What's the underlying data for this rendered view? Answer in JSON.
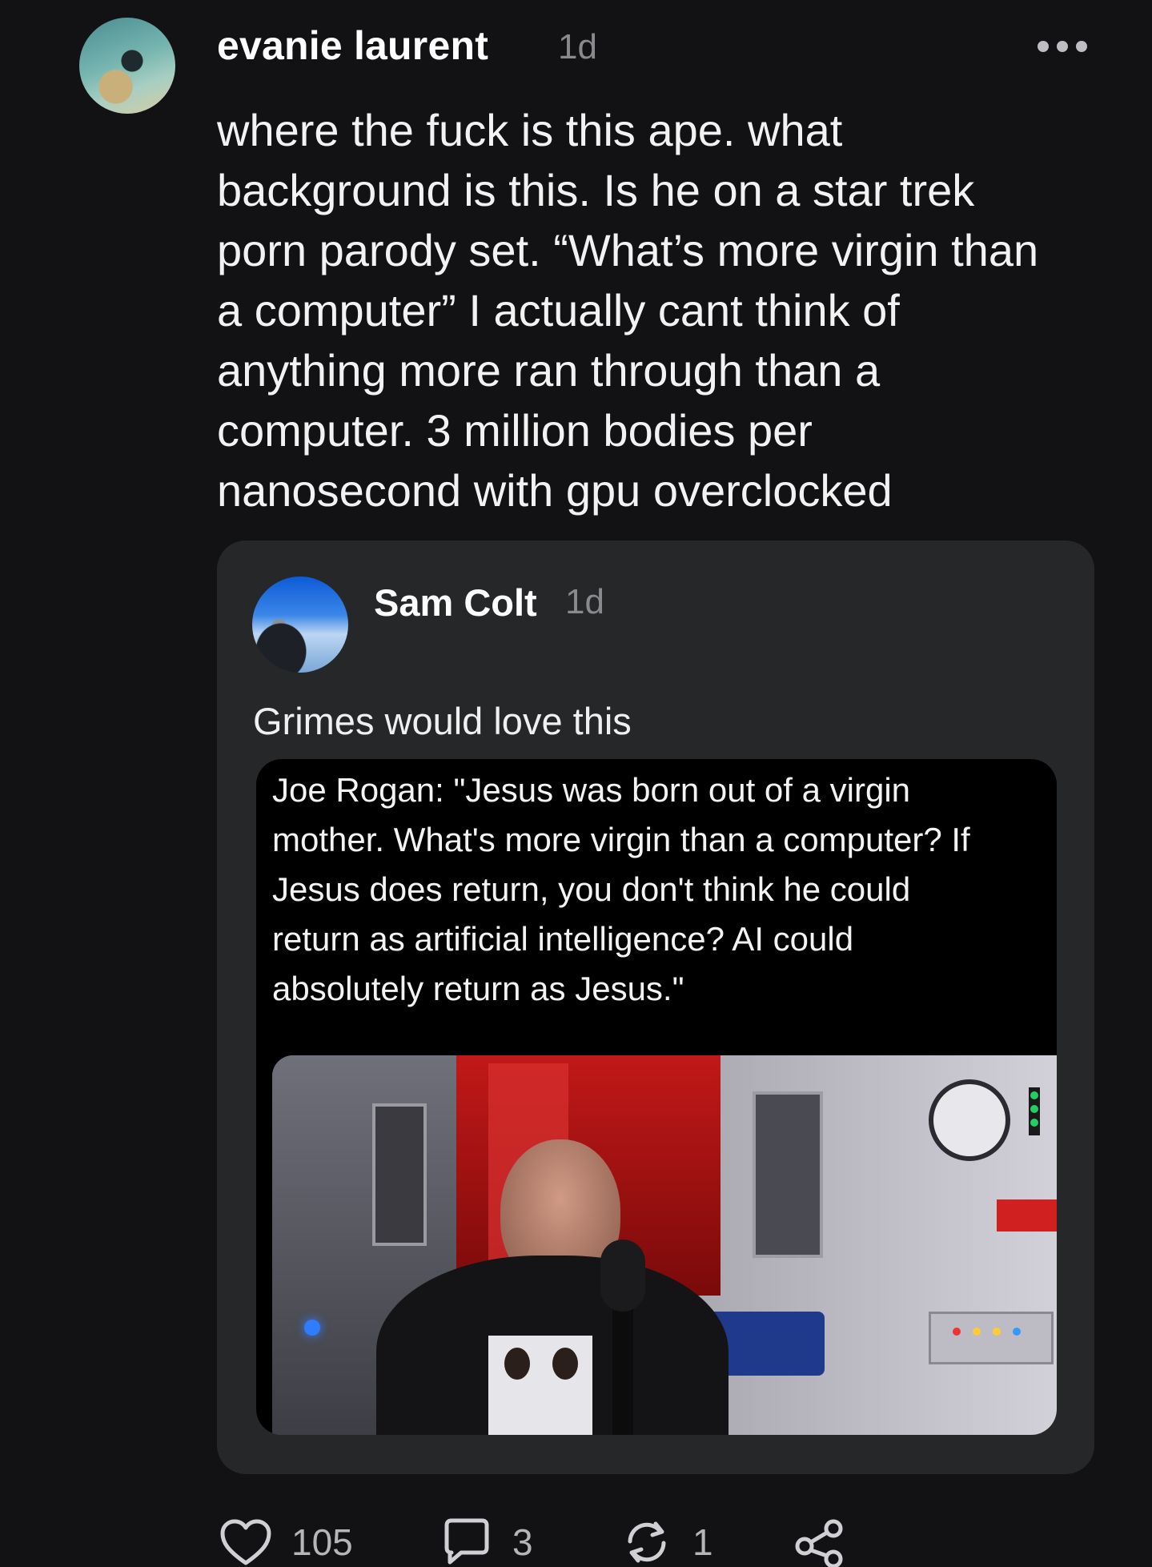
{
  "post": {
    "author": "evanie laurent",
    "time": "1d",
    "text_lines": [
      "where the fuck is this ape. what",
      "background is this. Is he on a star trek",
      "porn parody set. “What’s more virgin than",
      "a computer” I actually cant think of",
      "anything more ran through than a",
      "computer. 3 million bodies per",
      "nanosecond with gpu overclocked"
    ]
  },
  "quote": {
    "author": "Sam Colt",
    "time": "1d",
    "text": "Grimes would love this",
    "embed_lines": [
      "Joe Rogan: \"Jesus was born out of a virgin",
      "mother. What's more virgin than a computer? If",
      "Jesus does return, you don't think he could",
      "return as artificial intelligence? AI could",
      "absolutely return as Jesus.\""
    ]
  },
  "actions": {
    "likes": "105",
    "replies": "3",
    "reposts": "1"
  },
  "icons": [
    "more-icon",
    "heart-icon",
    "comment-icon",
    "repost-icon",
    "share-icon"
  ],
  "colors": {
    "background": "#121214",
    "card": "#262728",
    "muted": "#8a8a8e"
  }
}
